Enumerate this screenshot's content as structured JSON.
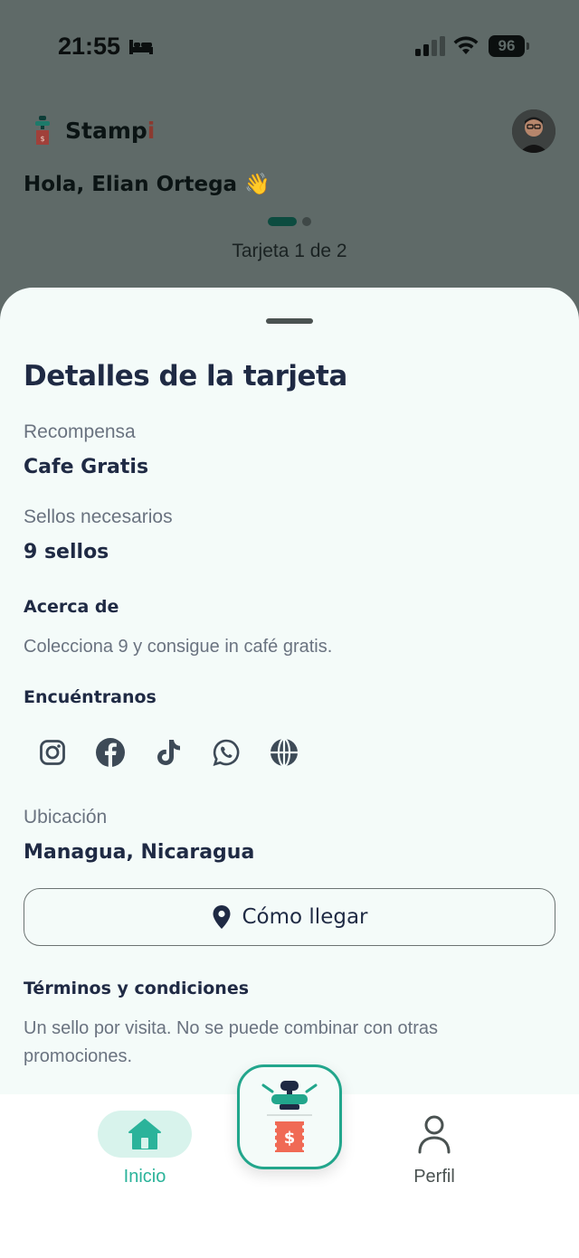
{
  "status_bar": {
    "time": "21:55",
    "battery": "96"
  },
  "header": {
    "brand_main": "Stamp",
    "brand_accent": "i",
    "greeting": "Hola, Elian Ortega 👋",
    "card_counter": "Tarjeta 1 de 2"
  },
  "sheet": {
    "title": "Detalles de la tarjeta",
    "reward_label": "Recompensa",
    "reward_value": "Cafe Gratis",
    "stamps_label": "Sellos necesarios",
    "stamps_value": "9 sellos",
    "about_label": "Acerca de",
    "about_text": "Colecciona 9 y consigue in café gratis.",
    "find_us_label": "Encuéntranos",
    "socials": [
      "instagram-icon",
      "facebook-icon",
      "tiktok-icon",
      "whatsapp-icon",
      "globe-icon"
    ],
    "location_label": "Ubicación",
    "location_value": "Managua, Nicaragua",
    "directions_button": "Cómo llegar",
    "terms_label": "Términos y condiciones",
    "terms_text": "Un sello por visita. No se puede combinar con otras promociones."
  },
  "bottom_nav": {
    "home_label": "Inicio",
    "profile_label": "Perfil"
  },
  "colors": {
    "accent": "#2bb39a",
    "text_dark": "#1f2a44",
    "text_muted": "#6a7380",
    "sheet_bg": "#f4fbf9"
  }
}
